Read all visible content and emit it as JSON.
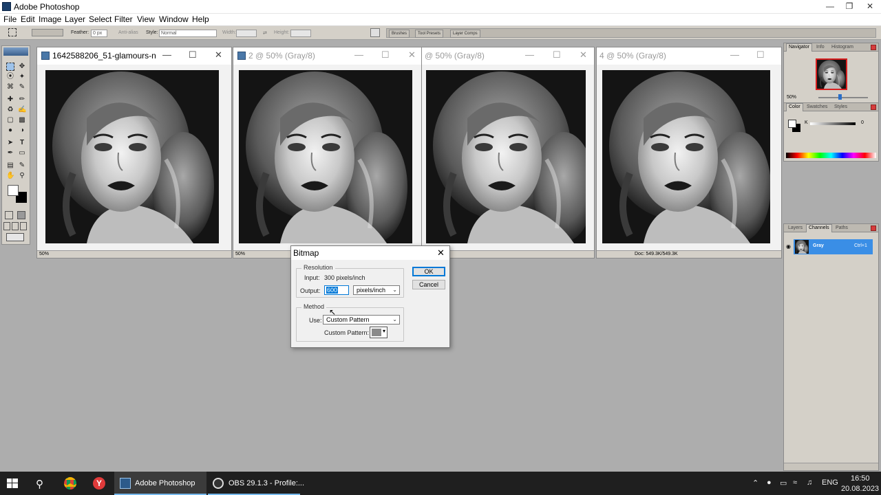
{
  "app": {
    "title": "Adobe Photoshop"
  },
  "menu": {
    "items": [
      "File",
      "Edit",
      "Image",
      "Layer",
      "Select",
      "Filter",
      "View",
      "Window",
      "Help"
    ]
  },
  "options": {
    "feather_label": "Feather:",
    "feather_value": "0 px",
    "antialias_label": "Anti-alias",
    "style_label": "Style:",
    "style_value": "Normal",
    "width_label": "Width:",
    "height_label": "Height:",
    "wells": [
      "Brushes",
      "Tool Presets",
      "Layer Comps"
    ]
  },
  "docs": [
    {
      "title": "1642588206_51-glamours-n...",
      "zoom": "50%",
      "active": true
    },
    {
      "title": "2 @ 50% (Gray/8)",
      "zoom": "50%",
      "active": false
    },
    {
      "title": "@ 50% (Gray/8)",
      "zoom": "",
      "active": false
    },
    {
      "title": "4 @ 50% (Gray/8)",
      "zoom": "",
      "doc_info": "Doc: 549.3K/549.3K",
      "active": false
    }
  ],
  "navigator": {
    "tabs": [
      "Navigator",
      "Info",
      "Histogram"
    ],
    "zoom": "50%"
  },
  "color_panel": {
    "tabs": [
      "Color",
      "Swatches",
      "Styles"
    ],
    "channel": "K",
    "value": "0"
  },
  "layers_panel": {
    "tabs": [
      "Layers",
      "Channels",
      "Paths"
    ],
    "channel_name": "Gray",
    "shortcut": "Ctrl+1"
  },
  "dialog": {
    "title": "Bitmap",
    "resolution_group": "Resolution",
    "input_label": "Input:",
    "input_value": "300 pixels/inch",
    "output_label": "Output:",
    "output_value": "600",
    "output_unit": "pixels/inch",
    "method_group": "Method",
    "use_label": "Use:",
    "use_value": "Custom Pattern",
    "custom_pattern_label": "Custom Pattern:",
    "ok": "OK",
    "cancel": "Cancel"
  },
  "taskbar": {
    "apps": [
      "Adobe Photoshop",
      "OBS 29.1.3 - Profile:..."
    ],
    "lang": "ENG",
    "time": "16:50",
    "date": "20.08.2023"
  },
  "colors": {
    "accent": "#0078d7",
    "selected_row": "#3a8ee6",
    "taskbar": "#1f1f1f"
  }
}
